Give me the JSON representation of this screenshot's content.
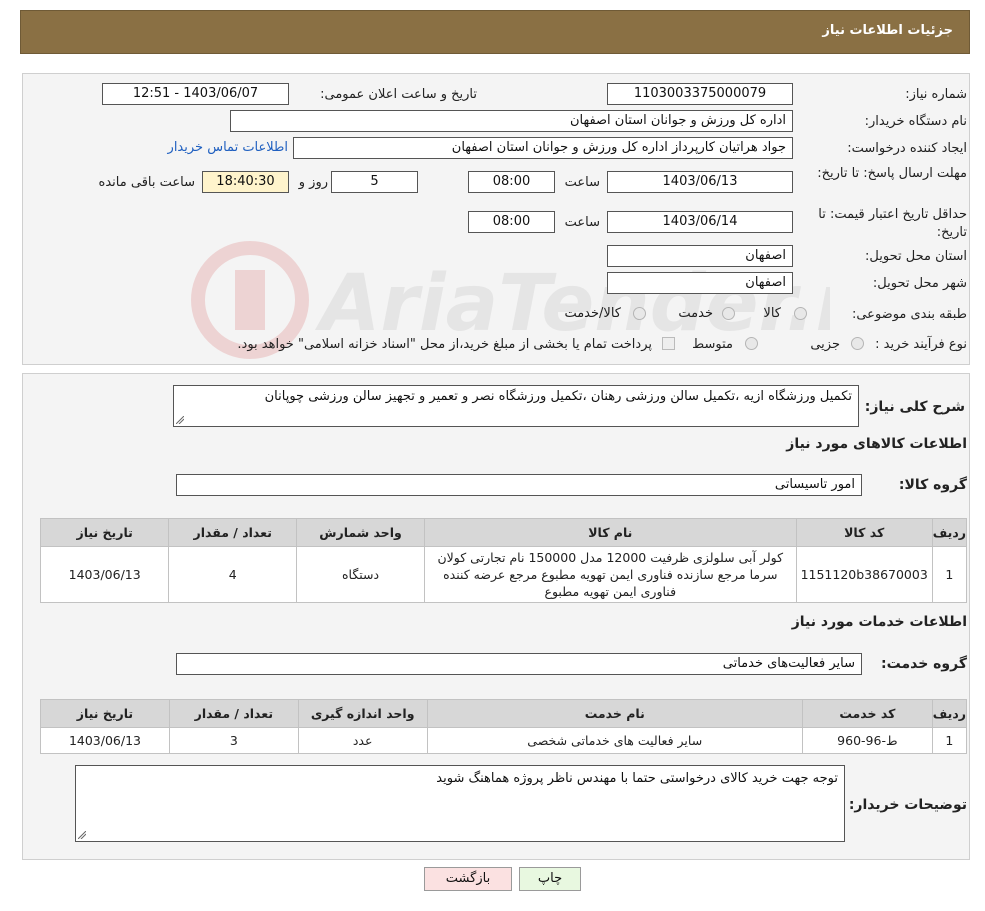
{
  "header": {
    "title": "جزئیات اطلاعات نیاز"
  },
  "info": {
    "need_number_label": "شماره نیاز:",
    "need_number": "1103003375000079",
    "announce_label": "تاریخ و ساعت اعلان عمومی:",
    "announce_value": "1403/06/07 - 12:51",
    "buyer_org_label": "نام دستگاه خریدار:",
    "buyer_org": "اداره کل ورزش و جوانان استان اصفهان",
    "creator_label": "ایجاد کننده درخواست:",
    "creator": "جواد هراتیان کارپرداز اداره کل ورزش و جوانان استان اصفهان",
    "contact_link": "اطلاعات تماس خریدار",
    "deadline_label": "مهلت ارسال پاسخ: تا تاریخ:",
    "deadline_date": "1403/06/13",
    "time_label": "ساعت",
    "deadline_time": "08:00",
    "days_value": "5",
    "days_label": "روز و",
    "remaining_time": "18:40:30",
    "remaining_label": "ساعت باقی مانده",
    "validity_label": "حداقل تاریخ اعتبار قیمت: تا تاریخ:",
    "validity_date": "1403/06/14",
    "validity_time": "08:00",
    "province_label": "استان محل تحویل:",
    "province": "اصفهان",
    "city_label": "شهر محل تحویل:",
    "city": "اصفهان",
    "category_label": "طبقه بندی موضوعی:",
    "category_options": [
      "کالا",
      "خدمت",
      "کالا/خدمت"
    ],
    "process_label": "نوع فرآیند خرید :",
    "process_options": [
      "جزیی",
      "متوسط"
    ],
    "process_note": "پرداخت تمام یا بخشی از مبلغ خرید،از محل \"اسناد خزانه اسلامی\" خواهد بود."
  },
  "description": {
    "label": "شرح کلی نیاز:",
    "value": "تکمیل ورزشگاه ازیه ،تکمیل سالن ورزشی رهنان ،تکمیل ورزشگاه نصر و تعمیر و تجهیز سالن ورزشی چوپانان"
  },
  "goods": {
    "section_title": "اطلاعات کالاهای مورد نیاز",
    "group_label": "گروه کالا:",
    "group_value": "امور تاسیساتی",
    "headers": [
      "ردیف",
      "کد کالا",
      "نام کالا",
      "واحد شمارش",
      "تعداد / مقدار",
      "تاریخ نیاز"
    ],
    "rows": [
      [
        "1",
        "1151120b38670003",
        "کولر آبی سلولزی ظرفیت 12000 مدل 150000 نام تجارتی کولان سرما مرجع سازنده فناوری ایمن تهویه مطبوع مرجع عرضه کننده فناوری ایمن تهویه مطبوع",
        "دستگاه",
        "4",
        "1403/06/13"
      ]
    ]
  },
  "services": {
    "section_title": "اطلاعات خدمات مورد نیاز",
    "group_label": "گروه خدمت:",
    "group_value": "سایر فعالیت‌های خدماتی",
    "headers": [
      "ردیف",
      "کد خدمت",
      "نام خدمت",
      "واحد اندازه گیری",
      "تعداد / مقدار",
      "تاریخ نیاز"
    ],
    "rows": [
      [
        "1",
        "ط-96-960",
        "سایر فعالیت های خدماتی شخصی",
        "عدد",
        "3",
        "1403/06/13"
      ]
    ]
  },
  "buyer_notes": {
    "label": "توضیحات خریدار:",
    "value": "توجه جهت خرید کالای درخواستی حتما با مهندس ناظر پروژه هماهنگ شوید"
  },
  "buttons": {
    "print": "چاپ",
    "back": "بازگشت"
  },
  "watermark": {
    "text": "AriaTender.neT"
  },
  "colors": {
    "header_bg": "#8a7044",
    "print_btn": "#e8f8e0",
    "back_btn": "#fbe1e1",
    "link": "#2060c0"
  }
}
